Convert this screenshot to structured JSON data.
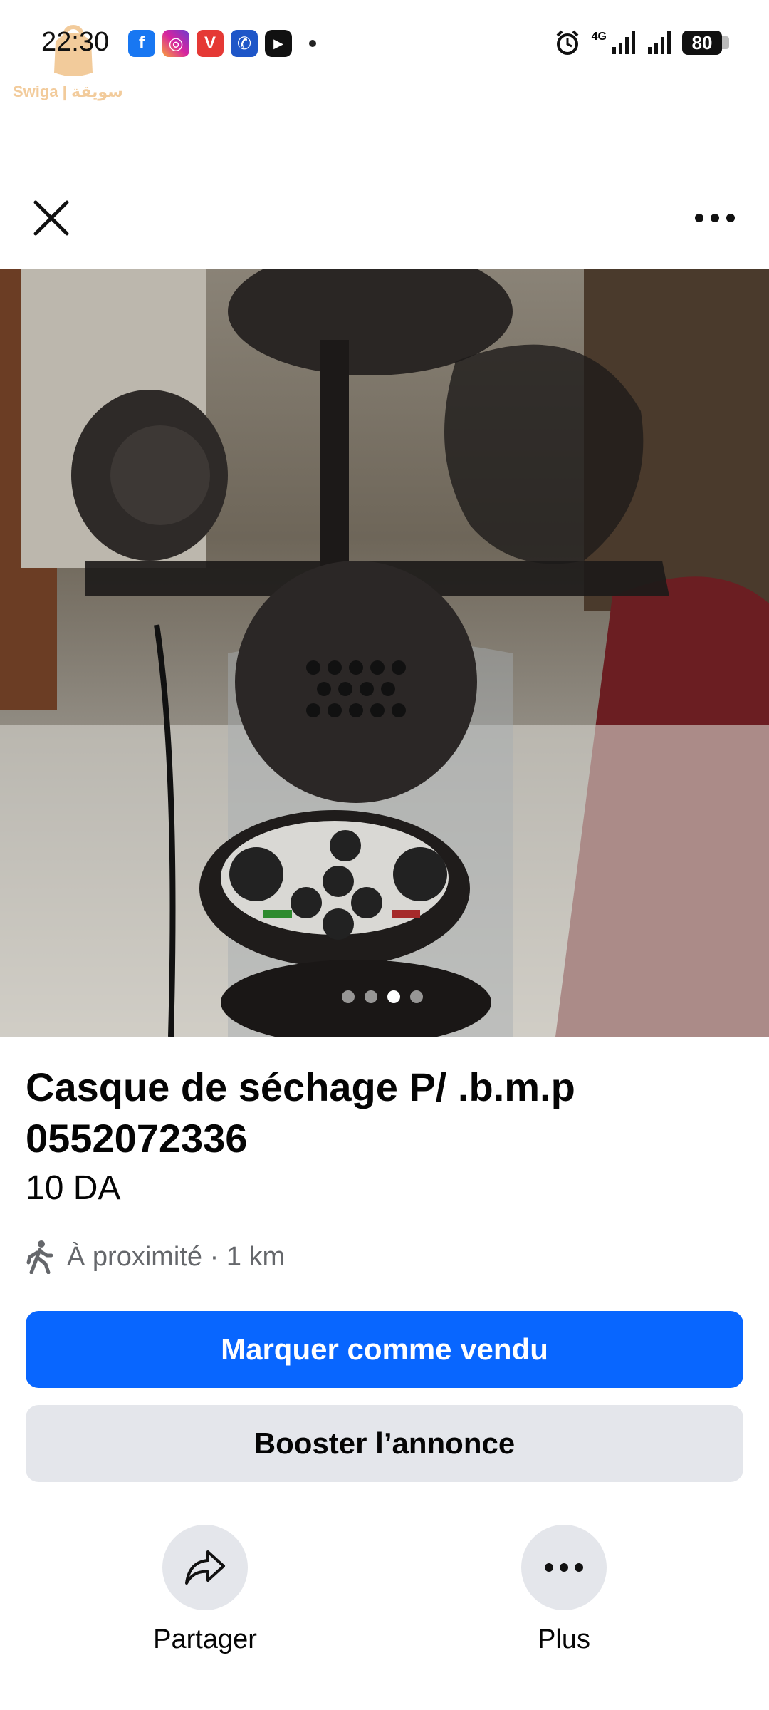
{
  "status_bar": {
    "time": "22:30",
    "network": "4G",
    "battery": "80",
    "apps": [
      {
        "icon": "facebook-icon",
        "glyph": "f",
        "color": "#1877f2"
      },
      {
        "icon": "instagram-icon",
        "glyph": "◎",
        "color": "#d6249f"
      },
      {
        "icon": "viber-like-icon",
        "glyph": "V",
        "color": "#e53935"
      },
      {
        "icon": "phone-app-icon",
        "glyph": "✆",
        "color": "#1e56c8"
      },
      {
        "icon": "youtube-icon",
        "glyph": "▶",
        "color": "#111111"
      }
    ]
  },
  "watermark": {
    "text": "Swiga | سويقة"
  },
  "topbar": {
    "close_icon": "close-icon",
    "more_icon": "more-horizontal-icon"
  },
  "listing": {
    "title_line1": "Casque de séchage P/ .b.m.p",
    "title_line2": "0552072336",
    "price": "10 DA",
    "location": "À proximité · 1 km",
    "carousel": {
      "count": 4,
      "active_index": 2
    }
  },
  "buttons": {
    "primary": "Marquer comme vendu",
    "secondary": "Booster l’annonce"
  },
  "actions": {
    "share": "Partager",
    "more": "Plus"
  },
  "colors": {
    "primary_button": "#0866ff",
    "secondary_button": "#e4e6eb",
    "secondary_text": "#65676b"
  }
}
